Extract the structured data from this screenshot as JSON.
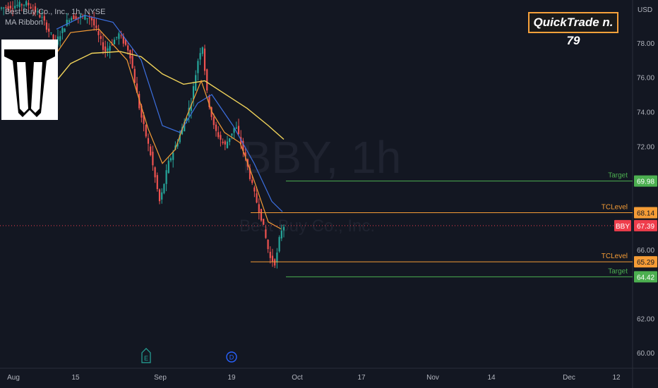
{
  "legend": {
    "symbol_line": "Best Buy Co., Inc., 1h, NYSE",
    "indicator": "MA Ribbon"
  },
  "watermark": {
    "ticker": "BBY, 1h",
    "company": "Best Buy Co., Inc."
  },
  "badge": {
    "text": "QuickTrade n. 79"
  },
  "currency": "USD",
  "colors": {
    "background": "#131722",
    "up_candle": "#26a69a",
    "down_candle": "#ef5350",
    "ma_fast": "#f59c36",
    "ma_mid": "#3c6fdf",
    "ma_slow": "#f0d35a",
    "target_line": "#4caf50",
    "tclevel_line": "#f59c36",
    "price_badge": "#ef3d4c"
  },
  "logo": {
    "icon": "stylized-T-logo"
  },
  "chart_data": {
    "type": "candlestick",
    "y_axis_ticks": [
      "78.00",
      "76.00",
      "74.00",
      "72.00",
      "66.00",
      "62.00",
      "60.00"
    ],
    "ylim": [
      59.6,
      80.0
    ],
    "x_axis_labels": [
      "Aug",
      "15",
      "Sep",
      "19",
      "Oct",
      "17",
      "Nov",
      "14",
      "Dec",
      "12"
    ],
    "levels": [
      {
        "label": "Target",
        "value": 69.98,
        "value_text": "69.98",
        "kind": "target"
      },
      {
        "label": "TCLevel",
        "value": 68.14,
        "value_text": "68.14",
        "kind": "tclevel"
      },
      {
        "label": "TCLevel",
        "value": 65.29,
        "value_text": "65.29",
        "kind": "tclevel"
      },
      {
        "label": "Target",
        "value": 64.42,
        "value_text": "64.42",
        "kind": "target"
      }
    ],
    "last_price": {
      "symbol": "BBY",
      "value": 67.39,
      "value_text": "67.39"
    },
    "events": [
      {
        "letter": "E",
        "kind": "earnings"
      },
      {
        "letter": "D",
        "kind": "dividend"
      }
    ]
  }
}
